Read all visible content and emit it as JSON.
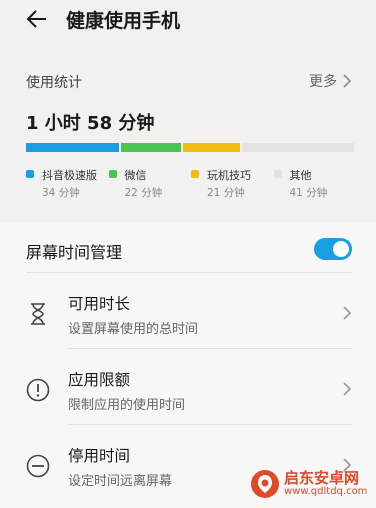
{
  "header": {
    "title": "健康使用手机"
  },
  "usage": {
    "section_label": "使用统计",
    "more_label": "更多",
    "total": "1 小时 58 分钟",
    "apps": [
      {
        "name": "抖音极速版",
        "time": "34 分钟",
        "minutes": 34,
        "color": "#1a9ee2"
      },
      {
        "name": "微信",
        "time": "22 分钟",
        "minutes": 22,
        "color": "#4bc450"
      },
      {
        "name": "玩机技巧",
        "time": "21 分钟",
        "minutes": 21,
        "color": "#f2bd12"
      },
      {
        "name": "其他",
        "time": "41 分钟",
        "minutes": 41,
        "color": "#e3e3e3"
      }
    ]
  },
  "management": {
    "label": "屏幕时间管理",
    "enabled": true,
    "items": [
      {
        "title": "可用时长",
        "subtitle": "设置屏幕使用的总时间",
        "icon": "hourglass-icon"
      },
      {
        "title": "应用限额",
        "subtitle": "限制应用的使用时间",
        "icon": "alert-circle-icon"
      },
      {
        "title": "停用时间",
        "subtitle": "设定时间远离屏幕",
        "icon": "minus-circle-icon"
      }
    ]
  },
  "watermark": {
    "name": "启东安卓网",
    "url": "www.qdltdq.com"
  }
}
